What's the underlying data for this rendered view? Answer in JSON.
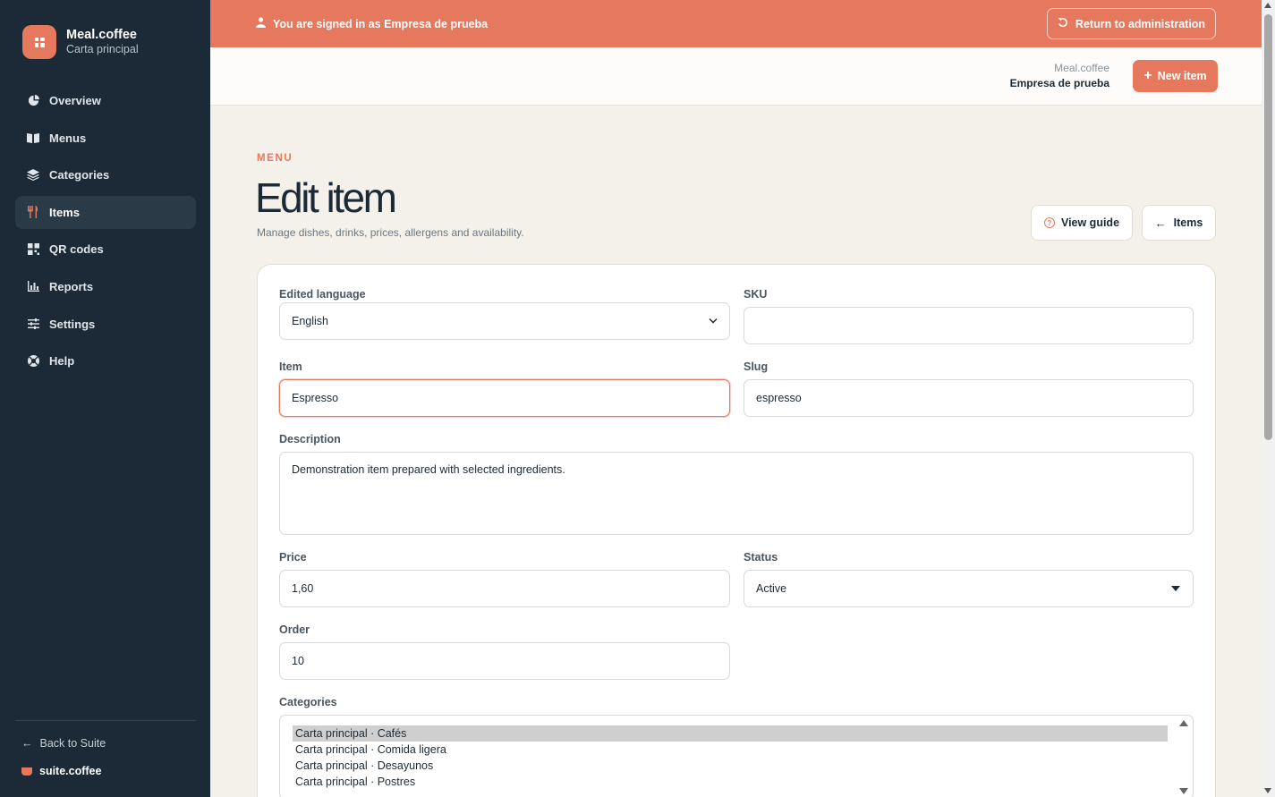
{
  "brand": {
    "name": "Meal.coffee",
    "subtitle": "Carta principal",
    "icon": "grid-logo-icon"
  },
  "nav": [
    {
      "label": "Overview",
      "icon": "pie-chart-icon",
      "active": false
    },
    {
      "label": "Menus",
      "icon": "book-icon",
      "active": false
    },
    {
      "label": "Categories",
      "icon": "layers-icon",
      "active": false
    },
    {
      "label": "Items",
      "icon": "utensils-icon",
      "active": true
    },
    {
      "label": "QR codes",
      "icon": "qr-icon",
      "active": false
    },
    {
      "label": "Reports",
      "icon": "chart-icon",
      "active": false
    },
    {
      "label": "Settings",
      "icon": "sliders-icon",
      "active": false
    },
    {
      "label": "Help",
      "icon": "lifebuoy-icon",
      "active": false
    }
  ],
  "sidebar_footer": {
    "back_label": "Back to Suite",
    "suite_label": "suite.coffee"
  },
  "banner": {
    "text": "You are signed in as Empresa de prueba",
    "return_label": "Return to administration"
  },
  "topbar": {
    "org_brand": "Meal.coffee",
    "org_company": "Empresa de prueba",
    "new_item_label": "New item"
  },
  "page": {
    "eyebrow": "MENU",
    "title": "Edit item",
    "subtitle": "Manage dishes, drinks, prices, allergens and availability.",
    "guide_label": "View guide",
    "items_label": "Items"
  },
  "form": {
    "language_label": "Edited language",
    "language_value": "English",
    "sku_label": "SKU",
    "sku_value": "",
    "item_label": "Item",
    "item_value": "Espresso",
    "slug_label": "Slug",
    "slug_value": "espresso",
    "description_label": "Description",
    "description_value": "Demonstration item prepared with selected ingredients.",
    "price_label": "Price",
    "price_value": "1,60",
    "status_label": "Status",
    "status_value": "Active",
    "order_label": "Order",
    "order_value": "10",
    "categories_label": "Categories",
    "categories": [
      {
        "label": "Carta principal · Cafés",
        "selected": true
      },
      {
        "label": "Carta principal · Comida ligera",
        "selected": false
      },
      {
        "label": "Carta principal · Desayunos",
        "selected": false
      },
      {
        "label": "Carta principal · Postres",
        "selected": false
      }
    ]
  },
  "colors": {
    "accent": "#e5785d",
    "sidebar": "#1b2a36",
    "background": "#f4f1ea"
  }
}
